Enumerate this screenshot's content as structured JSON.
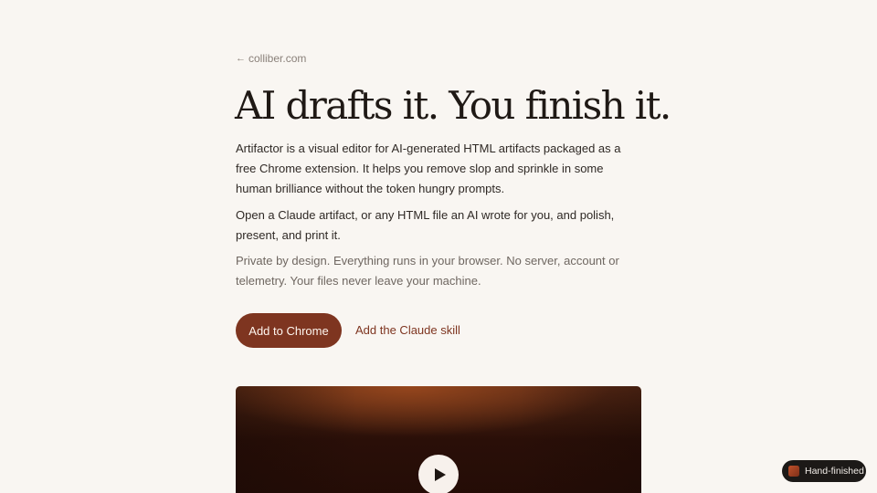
{
  "back_link": {
    "arrow": "←",
    "label": "colliber.com"
  },
  "hero": {
    "title": "AI drafts it. You finish it.",
    "paragraphs": [
      "Artifactor is a visual editor for AI-generated HTML artifacts packaged as a free Chrome extension. It helps you remove slop and sprinkle in some human brilliance without the token hungry prompts.",
      "Open a Claude artifact, or any HTML file an AI wrote for you, and polish, present, and print it.",
      "Private by design. Everything runs in your browser. No server, account or telemetry. Your files never leave your machine."
    ]
  },
  "actions": {
    "primary_label": "Add to Chrome",
    "secondary_label": "Add the Claude skill"
  },
  "video": {
    "play_icon": "play-icon"
  },
  "badge": {
    "label": "Hand-finished",
    "icon": "artifactor-logo-icon"
  },
  "colors": {
    "background": "#f9f6f2",
    "accent": "#7e3520",
    "text": "#2a2420",
    "muted_text": "#6f6761",
    "badge_bg": "#1c1917"
  }
}
